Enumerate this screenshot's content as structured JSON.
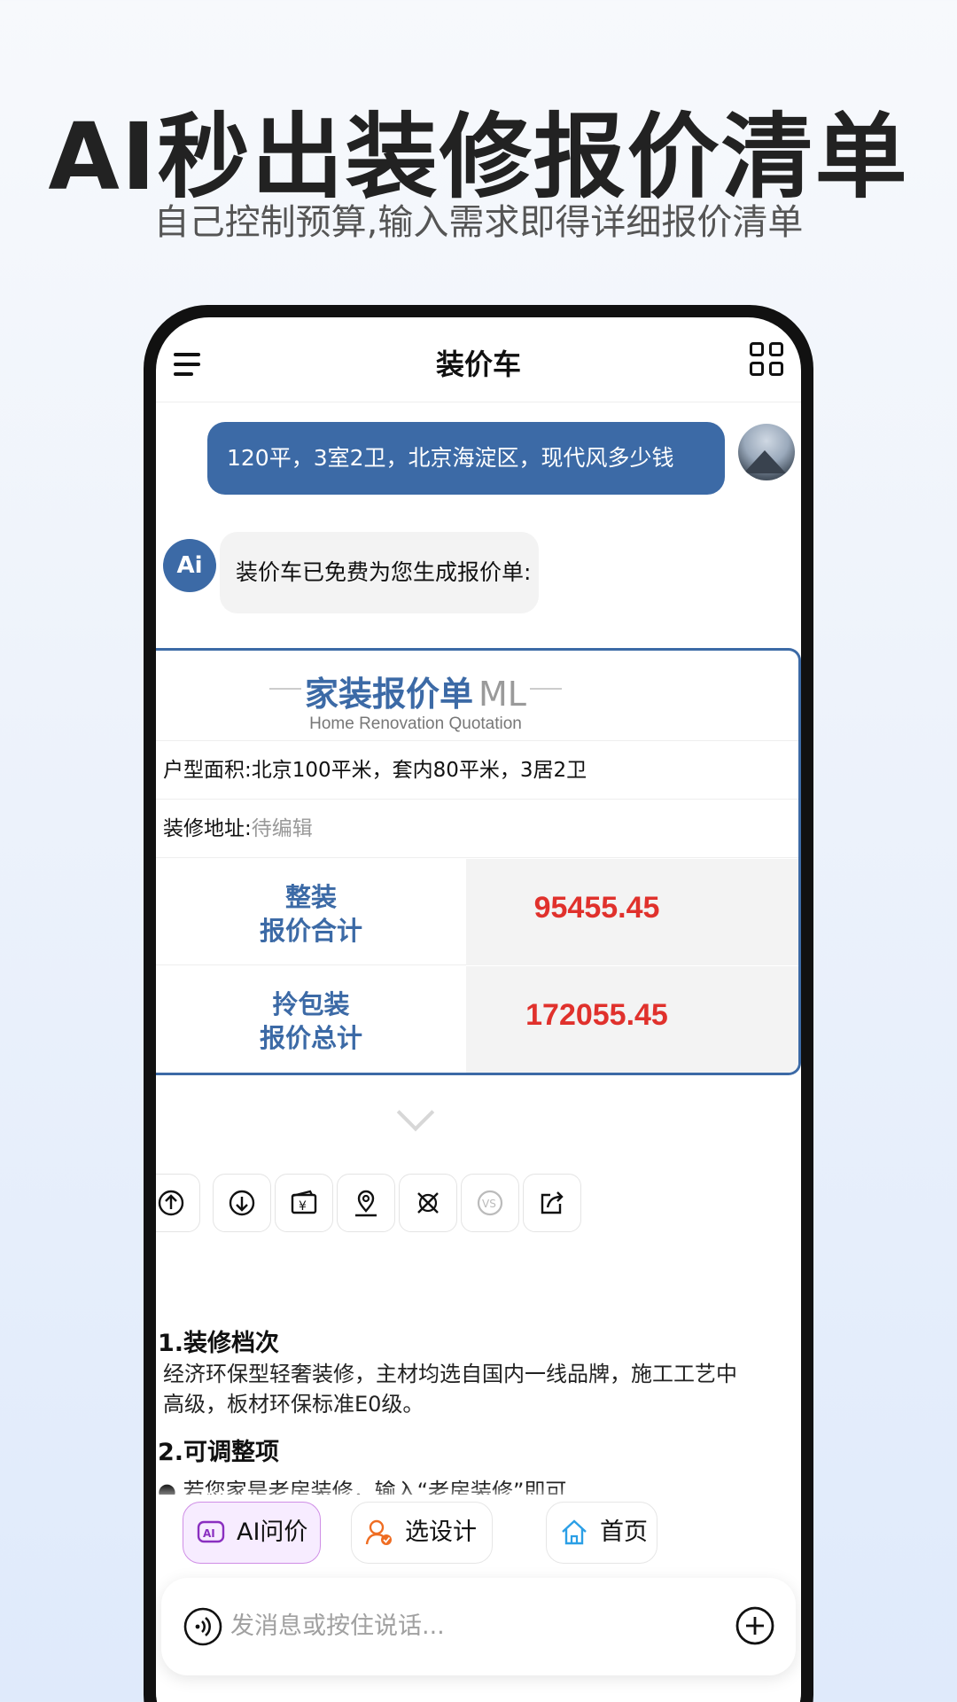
{
  "hero": {
    "headline": "AI秒出装修报价清单",
    "subline": "自己控制预算,输入需求即得详细报价清单"
  },
  "nav": {
    "title": "装价车"
  },
  "chat": {
    "user_message": "120平，3室2卫，北京海淀区，现代风多少钱",
    "bot_avatar_text": "Ai",
    "bot_message": "装价车已免费为您生成报价单:"
  },
  "quote": {
    "title": "家装报价单",
    "title_suffix": "ML",
    "subtitle": "Home Renovation Quotation",
    "area_line": "户型面积:北京100平米，套内80平米，3居2卫",
    "address_label": "装修地址:",
    "address_value": "待编辑",
    "rows": [
      {
        "label_line1": "整装",
        "label_line2": "报价合计",
        "value": "95455.45"
      },
      {
        "label_line1": "拎包装",
        "label_line2": "报价总计",
        "value": "172055.45"
      }
    ]
  },
  "actions": [
    {
      "icon": "upload-icon"
    },
    {
      "icon": "download-icon"
    },
    {
      "icon": "wallet-icon"
    },
    {
      "icon": "location-icon"
    },
    {
      "icon": "tools-icon"
    },
    {
      "icon": "vs-icon"
    },
    {
      "icon": "share-icon"
    }
  ],
  "sections": [
    {
      "title": "1.装修档次",
      "text_line1": "经济环保型轻奢装修，主材均选自国内一线品牌，施工工艺中",
      "text_line2": "高级，板材环保标准E0级。"
    },
    {
      "title": "2.可调整项",
      "text_line1": "● 若您家是老房装修，输入“老房装修”即可"
    }
  ],
  "quick_actions": [
    {
      "label": "AI问价",
      "icon": "ai-chat-icon"
    },
    {
      "label": "选设计师",
      "icon": "designer-icon"
    },
    {
      "label": "首页",
      "icon": "home-icon"
    }
  ],
  "input": {
    "placeholder": "发消息或按住说话..."
  },
  "colors": {
    "brand": "#3c6aa6",
    "price": "#e0312c",
    "ai_chip": "#cf8ee6"
  }
}
